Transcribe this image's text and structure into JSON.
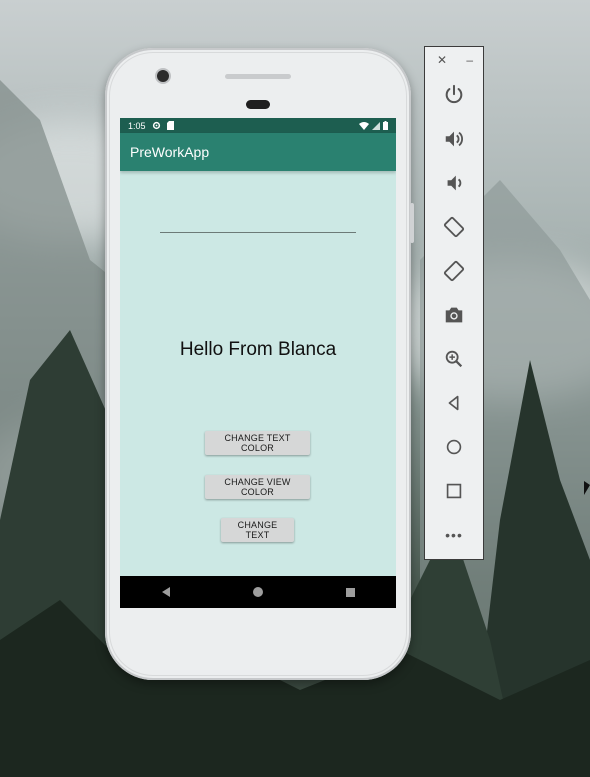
{
  "status_bar": {
    "time": "1:05"
  },
  "app_bar": {
    "title": "PreWorkApp"
  },
  "main": {
    "edit_text": "",
    "hello_text": "Hello From Blanca",
    "buttons": {
      "change_text_color": "CHANGE TEXT COLOR",
      "change_view_color": "CHANGE VIEW COLOR",
      "change_text": "CHANGE TEXT"
    }
  },
  "toolbar": {
    "close": "✕",
    "minimize": "–",
    "more": "•••"
  },
  "colors": {
    "status_bar": "#1d5e50",
    "app_bar": "#2a8170",
    "screen_background": "#cce8e4",
    "button": "#d6d7d7"
  },
  "icons": [
    "power-icon",
    "volume-up-icon",
    "volume-down-icon",
    "rotate-left-icon",
    "rotate-right-icon",
    "camera-icon",
    "zoom-icon",
    "back-icon",
    "home-icon",
    "overview-icon",
    "more-icon"
  ]
}
